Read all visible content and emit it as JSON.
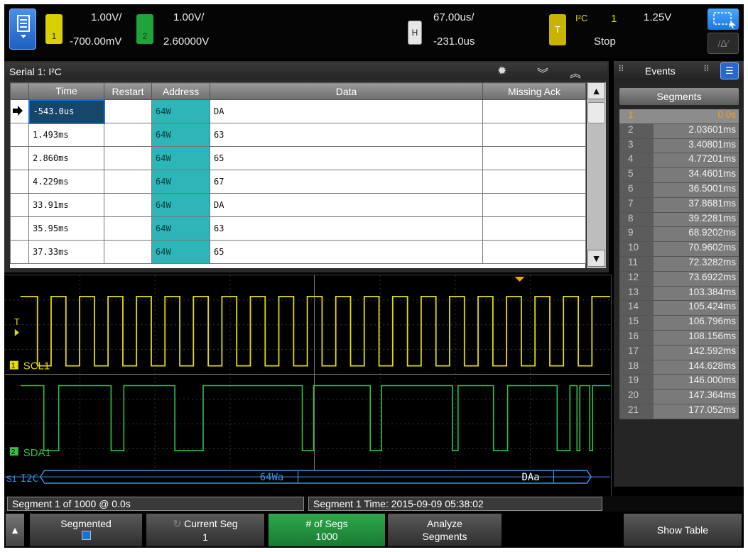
{
  "topbar": {
    "ch1": {
      "number": "1",
      "scale": "1.00V/",
      "offset": "-700.00mV",
      "color": "#e2dc00"
    },
    "ch2": {
      "number": "2",
      "scale": "1.00V/",
      "offset": "2.60000V",
      "color": "#2fc24a"
    },
    "horizontal": {
      "badge": "H",
      "timebase": "67.00us/",
      "delay": "-231.0us"
    },
    "trigger": {
      "badge": "T",
      "source": "I²C",
      "channel": "1",
      "level": "1.25V",
      "status": "Stop"
    }
  },
  "serial": {
    "title": "Serial 1: I²C",
    "columns": [
      "Time",
      "Restart",
      "Address",
      "Data",
      "Missing Ack"
    ],
    "rows": [
      {
        "time": "-543.0us",
        "restart": "",
        "address": "64W",
        "data": "DA",
        "ack": ""
      },
      {
        "time": "1.493ms",
        "restart": "",
        "address": "64W",
        "data": "63",
        "ack": ""
      },
      {
        "time": "2.860ms",
        "restart": "",
        "address": "64W",
        "data": "65",
        "ack": ""
      },
      {
        "time": "4.229ms",
        "restart": "",
        "address": "64W",
        "data": "67",
        "ack": ""
      },
      {
        "time": "33.91ms",
        "restart": "",
        "address": "64W",
        "data": "DA",
        "ack": ""
      },
      {
        "time": "35.95ms",
        "restart": "",
        "address": "64W",
        "data": "63",
        "ack": ""
      },
      {
        "time": "37.33ms",
        "restart": "",
        "address": "64W",
        "data": "65",
        "ack": ""
      }
    ]
  },
  "waveform": {
    "scl_label": "SCL1",
    "sda_label": "SDA1",
    "bus_label": "I2C",
    "bus_address": "64Wa",
    "bus_data": "DAa",
    "ground_ch1": "1",
    "ground_ch2": "2",
    "bus_number": "S1",
    "trigger_marker": "T"
  },
  "events": {
    "title": "Events",
    "tab": "Segments",
    "segments": [
      {
        "n": "1",
        "t": "0.0s"
      },
      {
        "n": "2",
        "t": "2.03601ms"
      },
      {
        "n": "3",
        "t": "3.40801ms"
      },
      {
        "n": "4",
        "t": "4.77201ms"
      },
      {
        "n": "5",
        "t": "34.4601ms"
      },
      {
        "n": "6",
        "t": "36.5001ms"
      },
      {
        "n": "7",
        "t": "37.8681ms"
      },
      {
        "n": "8",
        "t": "39.2281ms"
      },
      {
        "n": "9",
        "t": "68.9202ms"
      },
      {
        "n": "10",
        "t": "70.9602ms"
      },
      {
        "n": "11",
        "t": "72.3282ms"
      },
      {
        "n": "12",
        "t": "73.6922ms"
      },
      {
        "n": "13",
        "t": "103.384ms"
      },
      {
        "n": "14",
        "t": "105.424ms"
      },
      {
        "n": "15",
        "t": "106.796ms"
      },
      {
        "n": "16",
        "t": "108.156ms"
      },
      {
        "n": "17",
        "t": "142.592ms"
      },
      {
        "n": "18",
        "t": "144.628ms"
      },
      {
        "n": "19",
        "t": "146.000ms"
      },
      {
        "n": "20",
        "t": "147.364ms"
      },
      {
        "n": "21",
        "t": "177.052ms"
      }
    ]
  },
  "status": {
    "left": "Segment 1 of 1000 @ 0.0s",
    "right": "Segment 1 Time: 2015-09-09 05:38:02"
  },
  "softkeys": {
    "segmented": "Segmented",
    "current_seg": "Current Seg",
    "current_seg_value": "1",
    "num_segs": "# of Segs",
    "num_segs_value": "1000",
    "analyze": "Analyze",
    "analyze2": "Segments",
    "show_table": "Show Table"
  }
}
